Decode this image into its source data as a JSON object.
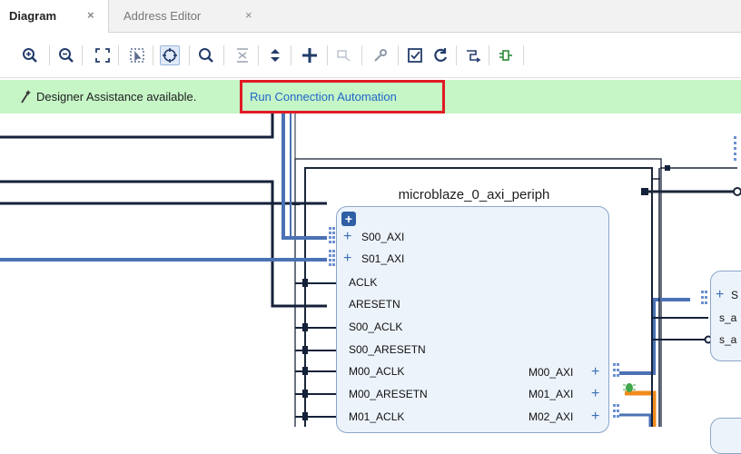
{
  "tabs": [
    {
      "label": "Diagram",
      "close": "×",
      "active": true
    },
    {
      "label": "Address Editor",
      "close": "×",
      "active": false
    }
  ],
  "toolbar": {
    "icons": [
      "zoom-in",
      "zoom-out",
      "fit-view",
      "fit-selection",
      "select-mode",
      "search",
      "collapse-all",
      "expand-all",
      "add-ip",
      "add-module",
      "customize",
      "validate-design",
      "regenerate-layout",
      "optimize-routing",
      "pin-block"
    ]
  },
  "banner": {
    "text": "Designer Assistance available.",
    "link": "Run Connection Automation",
    "background": "#c6f5c6",
    "highlight_color": "#e01b24"
  },
  "diagram": {
    "ip_name": "microblaze_0_axi_periph",
    "expand_symbol": "+",
    "bus_ports_left": [
      "S00_AXI",
      "S01_AXI"
    ],
    "ports_left": [
      "ACLK",
      "ARESETN",
      "S00_ACLK",
      "S00_ARESETN",
      "M00_ACLK",
      "M00_ARESETN",
      "M01_ACLK"
    ],
    "ports_right": [
      "M00_AXI",
      "M01_AXI",
      "M02_AXI"
    ],
    "plus_symbol": "+",
    "right_block_ports": [
      "S",
      "s_a",
      "s_a"
    ],
    "colors": {
      "bus": "#4a72b4",
      "wire": "#14213a",
      "block_fill": "#edf3fb",
      "block_border": "#8aa6c8",
      "highlight_wire": "#f08a1c"
    }
  }
}
